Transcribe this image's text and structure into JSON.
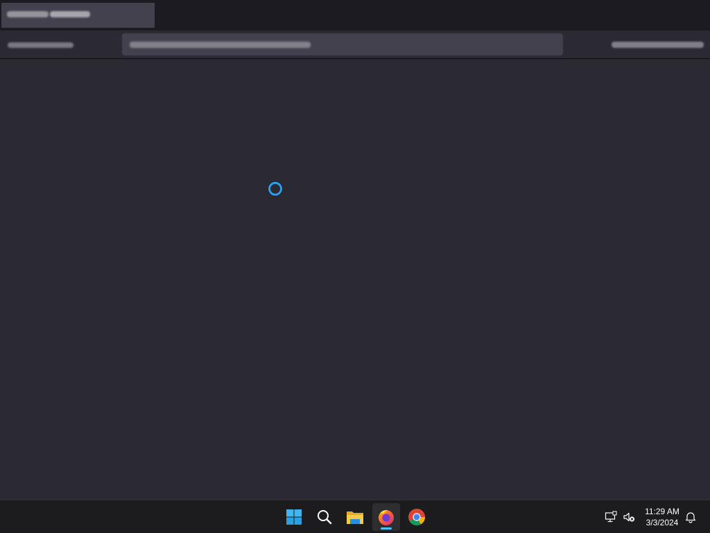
{
  "browser": {
    "tab_title": "",
    "url": ""
  },
  "taskbar": {
    "icons": [
      "windows-start-icon",
      "search-icon",
      "file-explorer-icon",
      "firefox-icon",
      "chrome-icon"
    ],
    "active_app": "firefox",
    "clock": {
      "time": "11:29 AM",
      "date": "3/3/2024"
    },
    "tray": [
      "network-icon",
      "volume-muted-icon",
      "notifications-icon"
    ]
  },
  "colors": {
    "accent": "#4cc2ff",
    "spinner": "#2a9ff0",
    "content_bg": "#2b2a33",
    "tab_strip_bg": "#1c1b22",
    "taskbar_bg": "#1c1c1e"
  }
}
